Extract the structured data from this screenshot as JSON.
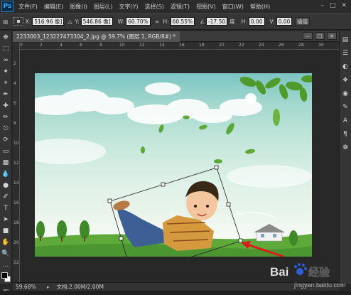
{
  "app": {
    "logo": "Ps"
  },
  "menu": {
    "items": [
      "文件(F)",
      "编辑(E)",
      "图像(I)",
      "图层(L)",
      "文字(Y)",
      "选择(S)",
      "滤镜(T)",
      "视图(V)",
      "窗口(W)",
      "帮助(H)"
    ]
  },
  "options": {
    "x_label": "X:",
    "x_value": "516.96 像]",
    "y_label": "Y:",
    "y_value": "546.86 像]",
    "w_label": "W:",
    "w_value": "60.70%",
    "h_label": "H:",
    "h_value": "60.55%",
    "angle_value": "-17.50",
    "angle_unit": "度",
    "hskew_label": "H:",
    "hskew_value": "0.00",
    "vskew_label": "V:",
    "vskew_value": "0.00",
    "interp_label": "插值"
  },
  "document": {
    "tab_title": "2233003_123227473304_2.jpg @ 59.7% (图层 1, RGB/8#) *"
  },
  "ruler": {
    "top_ticks": [
      "0",
      "2",
      "4",
      "6",
      "8",
      "10",
      "12",
      "14",
      "16",
      "18",
      "20",
      "22",
      "24",
      "26",
      "28",
      "30"
    ],
    "left_ticks": [
      "2",
      "4",
      "6",
      "8",
      "10",
      "12",
      "14",
      "16",
      "18",
      "20",
      "22"
    ]
  },
  "status": {
    "zoom": "59.68%",
    "doc_info": "文档:2.00M/2.00M"
  },
  "watermark": {
    "line1": "Bai",
    "line1b": "经验",
    "line2": "jingyan.baidu.com"
  },
  "colors": {
    "arrow": "#e0191b",
    "sky_top": "#7cc5c3",
    "grass": "#5fa83a"
  }
}
